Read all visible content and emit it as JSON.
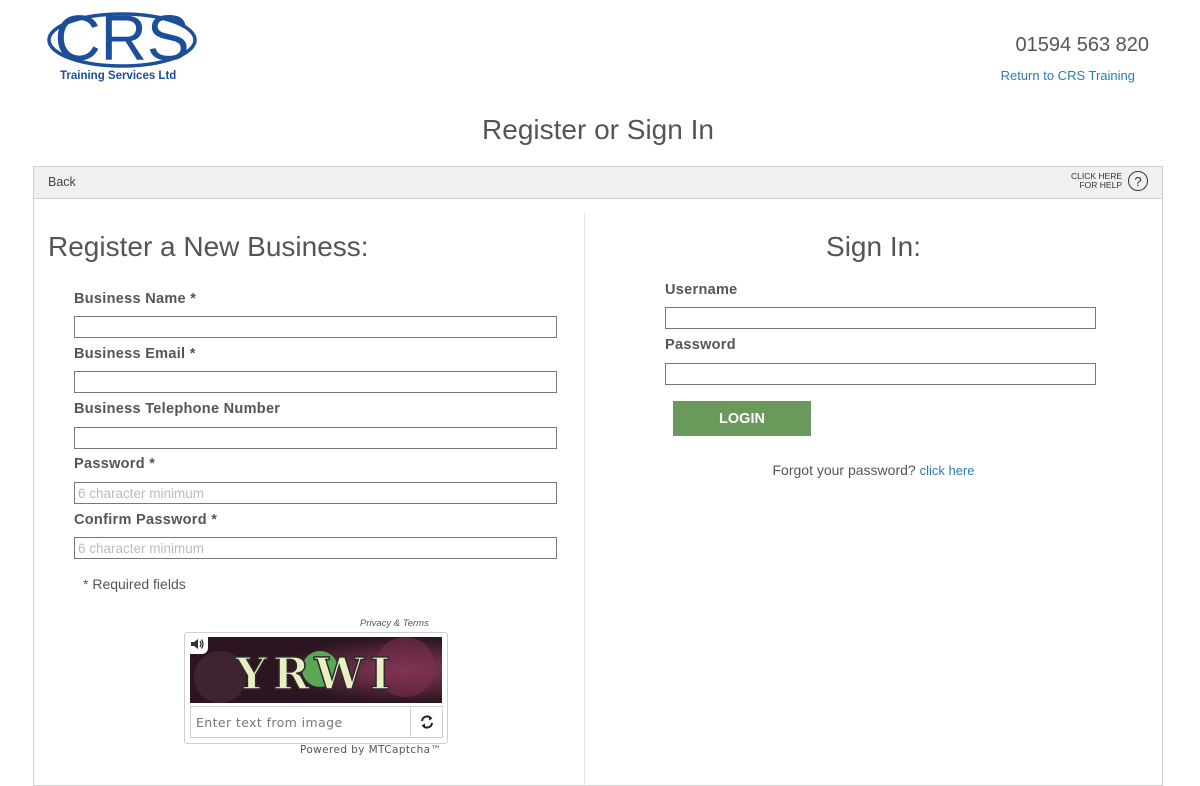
{
  "header": {
    "logo_text": "CRS",
    "logo_subtitle": "Training Services Ltd",
    "phone": "01594 563 820",
    "return_link": "Return to CRS Training"
  },
  "page_title": "Register or Sign In",
  "toolbar": {
    "back_label": "Back",
    "help_line1": "CLICK HERE",
    "help_line2": "FOR HELP",
    "help_glyph": "?"
  },
  "register": {
    "title": "Register a New Business:",
    "fields": [
      {
        "label": "Business Name *",
        "value": "",
        "placeholder": ""
      },
      {
        "label": "Business Email *",
        "value": "",
        "placeholder": ""
      },
      {
        "label": "Business Telephone Number",
        "value": "",
        "placeholder": ""
      },
      {
        "label": "Password *",
        "value": "",
        "placeholder": "6 character minimum"
      },
      {
        "label": "Confirm Password *",
        "value": "",
        "placeholder": "6 character minimum"
      }
    ],
    "required_note": "* Required fields"
  },
  "signin": {
    "title": "Sign In:",
    "username_label": "Username",
    "password_label": "Password",
    "login_label": "LOGIN",
    "forgot_text": "Forgot your password?",
    "forgot_link": "click here"
  },
  "captcha": {
    "privacy_terms": "Privacy & Terms",
    "image_text": "YRWI",
    "input_placeholder": "Enter text from image",
    "powered_by": "Powered by MTCaptcha™"
  },
  "colors": {
    "brand_blue": "#1c4e9a",
    "link": "#2e7bb0",
    "login_green": "#6a9a5b"
  }
}
